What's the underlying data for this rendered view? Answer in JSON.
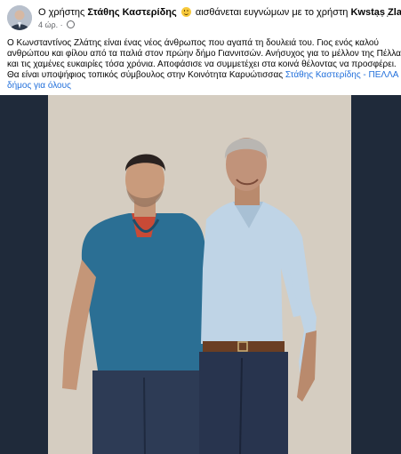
{
  "post": {
    "author_prefix": "Ο χρήστης",
    "author": "Στάθης Καστερίδης",
    "feeling": "αισθάνεται ευγνώμων με το χρήστη",
    "tagged": "Kwstas Zlatis.",
    "time": "4 ώρ.",
    "more_label": "···",
    "text_lines": [
      "Ο Κωνσταντίνος Ζλάτης είναι ένας νέος άνθρωπος που αγαπά τη δουλειά του. Γιος ενός καλού",
      "ανθρώπου και φίλου από τα παλιά στον πρώην δήμο Γιαννιτσών. Ανήσυχος για το μέλλον της Πέλλας",
      "και τις χαμένες ευκαιρίες τόσα χρόνια. Αποφάσισε να συμμετέχει στα κοινά θέλοντας να προσφέρει.",
      "Θα είναι υποψήφιος τοπικός σύμβουλος στην Κοινότητα Καρυώτισσας"
    ],
    "text_link_inline": "Στάθης Καστερίδης - ΠΕΛΛΑ",
    "text_link_last": "δήμος για όλους"
  },
  "icons": {
    "avatar": "profile-avatar",
    "emoji": "grateful-emoji-icon",
    "privacy": "globe-icon",
    "more": "more-options-icon"
  },
  "colors": {
    "link": "#216fdb",
    "meta": "#65676b",
    "photo_frame": "#1f2a3a",
    "wall": "#d9d2c6"
  }
}
